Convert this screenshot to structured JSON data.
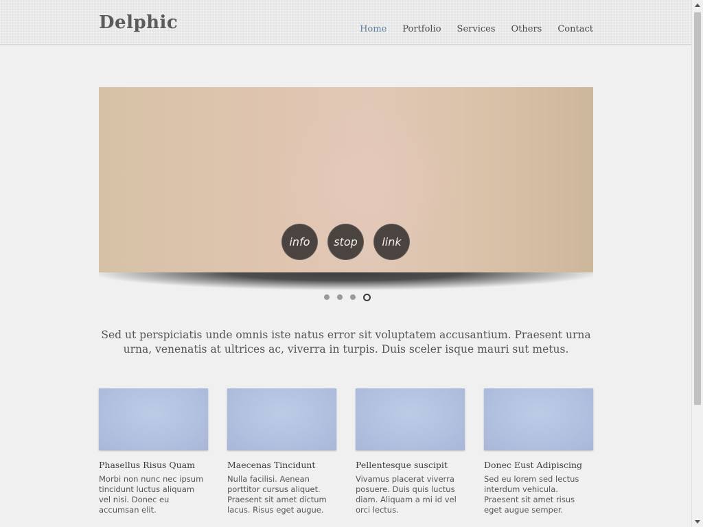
{
  "header": {
    "logo": "Delphic",
    "nav": [
      "Home",
      "Portfolio",
      "Services",
      "Others",
      "Contact"
    ]
  },
  "slider": {
    "buttons": [
      "info",
      "stop",
      "link"
    ],
    "active_slide": 4,
    "total_slides": 4
  },
  "intro": "Sed ut perspiciatis unde omnis iste natus error sit voluptatem accusantium. Praesent urna urna, venenatis at ultrices ac, viverra in turpis. Duis sceler isque mauri sut metus.",
  "features": [
    {
      "title": "Phasellus Risus Quam",
      "text": "Morbi non nunc nec ipsum tincidunt luctus aliquam vel nisi. Donec eu accumsan elit."
    },
    {
      "title": "Maecenas Tincidunt",
      "text": "Nulla facilisi. Aenean porttitor cursus aliquet. Praesent sit amet dictum lacus. Risus eget augue."
    },
    {
      "title": "Pellentesque suscipit",
      "text": "Vivamus placerat viverra posuere. Duis quis luctus diam. Aliquam a mi id vel orci lectus."
    },
    {
      "title": "Donec Eust Adipiscing",
      "text": "Sed eu lorem sed lectus interdum vehicula. Praesent sit amet risus eget augue semper."
    }
  ],
  "colors": {
    "background": "#f0f0f0",
    "nav_active": "#5b7f9c",
    "slider_button": "#4a4340",
    "thumbnail": "#b1c0df"
  }
}
